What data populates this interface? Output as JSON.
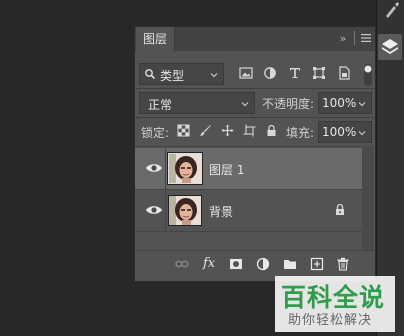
{
  "panel": {
    "tab_label": "图层",
    "collapse_glyph": "»",
    "menu_icon": "hamburger-icon"
  },
  "filter": {
    "kind_label": "类型",
    "icons": [
      "image-filter-icon",
      "adjustment-filter-icon",
      "type-filter-icon",
      "shape-filter-icon",
      "smart-object-filter-icon"
    ]
  },
  "blend": {
    "mode": "正常",
    "opacity_label": "不透明度:",
    "opacity_value": "100%"
  },
  "lock": {
    "label": "锁定:",
    "fill_label": "填充:",
    "fill_value": "100%"
  },
  "layers": [
    {
      "name": "图层 1",
      "selected": true,
      "visible": true,
      "locked": false
    },
    {
      "name": "背景",
      "selected": false,
      "visible": true,
      "locked": true
    }
  ],
  "bottom_icons": [
    "link-layers-icon",
    "fx-icon",
    "mask-icon",
    "adjustment-layer-icon",
    "group-folder-icon",
    "new-layer-icon",
    "delete-icon"
  ],
  "bottom_fx_label": "fx",
  "watermark": {
    "title": "百科全说",
    "subtitle": "助你轻松解决"
  },
  "colors": {
    "panel_bg": "#535353",
    "selected_row": "#6a6a6a",
    "watermark_green": "#2e9e4a"
  }
}
